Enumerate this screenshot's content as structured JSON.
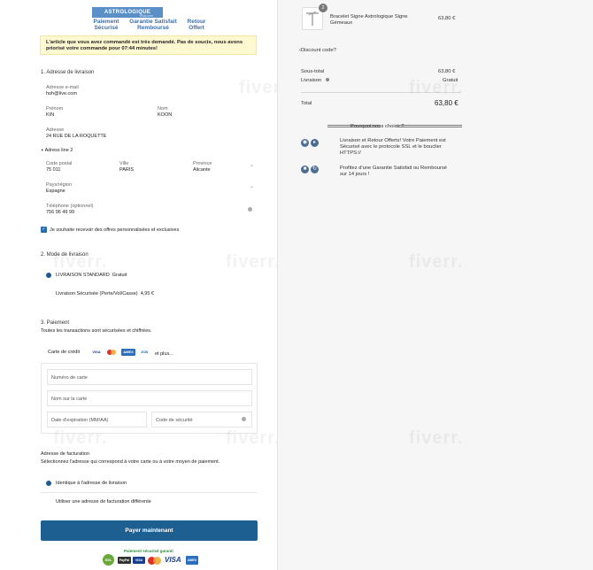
{
  "logo": {
    "text": "ASTROLOGIQUE",
    "sub": "shop.com"
  },
  "header_badges": [
    {
      "line1": "Paiement",
      "line2": "Sécurisé"
    },
    {
      "line1": "Garantie Satisfait",
      "line2": "Remboursé"
    },
    {
      "line1": "Retour",
      "line2": "Offert"
    }
  ],
  "banner": "L'article que vous avez commandé est très demandé. Pas de soucis, nous avons priorisé votre commande pour 07:44 minutes!",
  "shipping": {
    "title": "1. Adresse de livraison",
    "email_label": "Adresse e-mail",
    "email_value": "hoh@live.com",
    "firstname_label": "Prénom",
    "firstname_value": "KIN",
    "lastname_label": "Nom",
    "lastname_value": "KOON",
    "address_label": "Adresse",
    "address_value": "24 RUE DE LA ROQUETTE",
    "address2_label": "Adress line 2",
    "postal_label": "Code postal",
    "postal_value": "75 011",
    "city_label": "Ville",
    "city_value": "PARIS",
    "province_label": "Province",
    "province_value": "Alicante",
    "country_label": "Pays/région",
    "country_value": "Espagne",
    "phone_label": "Téléphone (optionnel)",
    "phone_value": "756 96 49 99",
    "newsletter_label": "Je souhaite recevoir des offres personnalisées et exclusives"
  },
  "delivery": {
    "title": "2. Mode de livraison",
    "option1_label": "LIVRAISON STANDARD",
    "option1_price": "Gratuit",
    "option2_label": "Livraison Sécurisée (Perte/Vol/Casse)",
    "option2_price": "4,95 €"
  },
  "payment": {
    "title": "3. Paiement",
    "subtitle": "Toutes les transactions sont sécurisées et chiffrées.",
    "card_label": "Carte de crédit",
    "more": "et plus...",
    "card_number_placeholder": "Numéro de carte",
    "card_name_placeholder": "Nom sur la carte",
    "expiry_placeholder": "Date d'expiration (MM/AA)",
    "cvc_placeholder": "Code de sécurité"
  },
  "billing": {
    "title": "Adresse de facturation",
    "subtitle": "Sélectionnez l'adresse qui correspond à votre carte ou à votre moyen de paiement.",
    "option1": "Identique à l'adresse de livraison",
    "option2": "Utiliser une adresse de facturation différente"
  },
  "pay_button": "Payer maintenant",
  "footer_secure": "Paiement sécurisé garanti",
  "footer_logos": [
    "SSL",
    "PayPal",
    "VISA",
    "MC",
    "VISA",
    "AMEX"
  ],
  "summary": {
    "item_name": "Bracelet Signe Astrologique Signe Gémeaux",
    "item_qty": "2",
    "item_price": "63,80 €",
    "discount_label": "Discount code?",
    "subtotal_label": "Sous-total",
    "subtotal_value": "63,80 €",
    "shipping_label": "Livraison",
    "shipping_value": "Gratuit",
    "total_label": "Total",
    "total_value": "63,80 €",
    "why_title": "Pourquoi nous choisir ?",
    "why1": "Livraison et Retour Offerts! Votre Paiement est Sécurisé avec le protocole SSL et le bouclier HTTPS://",
    "why2": "Profitez d'une Garantie Satisfait ou Remboursé sur 14 jours !"
  },
  "watermark": "fiverr.",
  "colors": {
    "accent": "#1e5f92",
    "banner_bg": "#fff9d1",
    "sidebar_bg": "#f6f6f6"
  }
}
